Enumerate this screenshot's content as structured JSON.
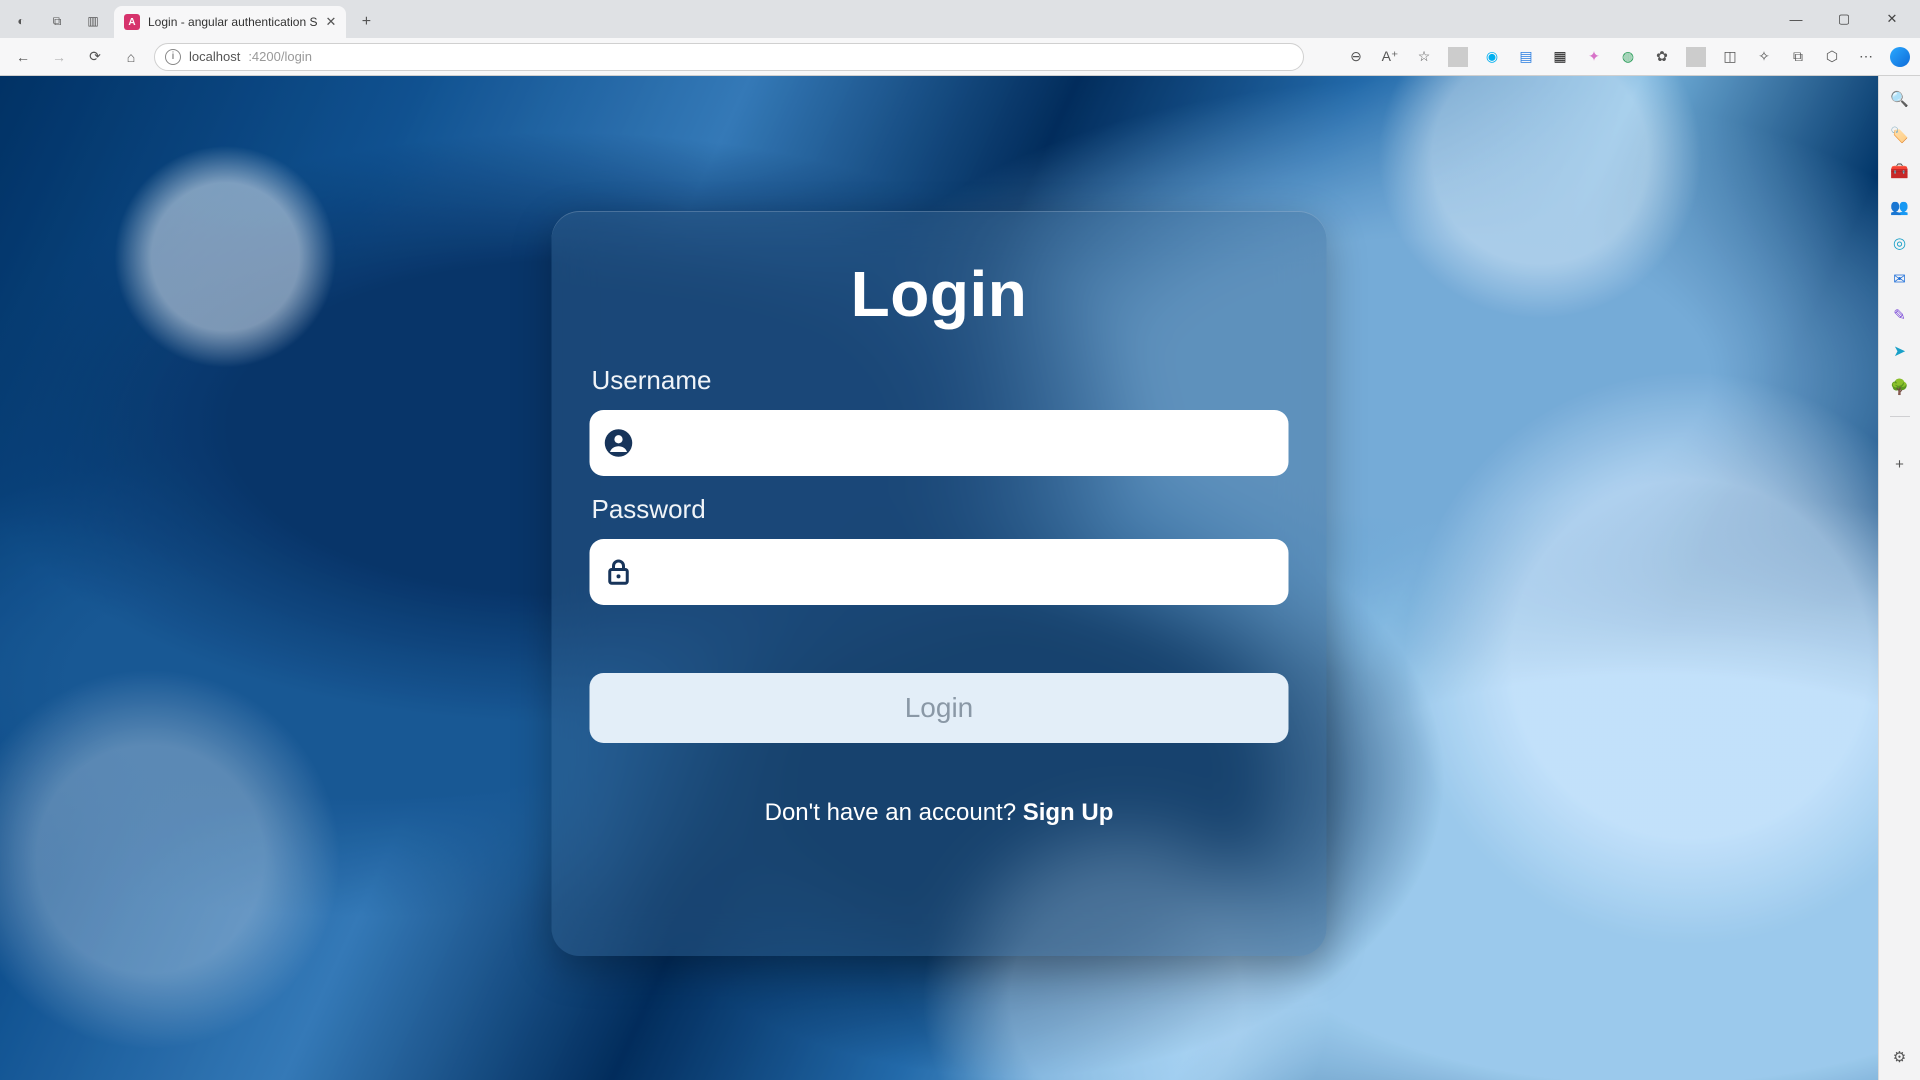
{
  "browser": {
    "tab_title": "Login - angular authentication S",
    "url_host": "localhost",
    "url_port_path": ":4200/login",
    "new_tab_glyph": "+",
    "close_glyph": "✕",
    "window": {
      "min": "—",
      "max": "▢",
      "close": "✕"
    }
  },
  "sidebar": {
    "icons": [
      "search",
      "tag",
      "briefcase",
      "people",
      "chat",
      "outlook",
      "wand",
      "send",
      "tree"
    ],
    "plus": "+",
    "gear": "⚙"
  },
  "login": {
    "title": "Login",
    "username_label": "Username",
    "password_label": "Password",
    "username_value": "",
    "password_value": "",
    "button_label": "Login",
    "cta_prefix": "Don't have an account? ",
    "cta_link": "Sign Up"
  },
  "colors": {
    "card_tint": "rgba(58,103,145,0.38)",
    "button_bg": "#e3eef8",
    "button_fg": "#8a98a6",
    "input_icon": "#17345a"
  }
}
